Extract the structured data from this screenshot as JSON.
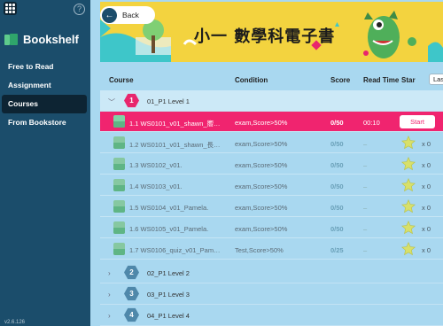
{
  "sidebar": {
    "brand": "Bookshelf",
    "help": "?",
    "items": [
      {
        "label": "Free to Read"
      },
      {
        "label": "Assignment"
      },
      {
        "label": "Courses",
        "active": true
      },
      {
        "label": "From Bookstore"
      }
    ],
    "version": "v2.6.126"
  },
  "header": {
    "back_label": "Back",
    "banner_title": "小一 數學科電子書"
  },
  "table": {
    "columns": {
      "course": "Course",
      "condition": "Condition",
      "score": "Score",
      "read_time": "Read Time",
      "star": "Star",
      "sort": "Last"
    },
    "open_level": {
      "number": "1",
      "name": "01_P1 Level 1"
    },
    "items": [
      {
        "course": "1.1  WS0101_v01_shawn_嚮…",
        "condition": "exam,Score>50%",
        "score": "0/50",
        "time": "00:10",
        "action": "Start"
      },
      {
        "course": "1.2  WS0101_v01_shawn_長…",
        "condition": "exam,Score>50%",
        "score": "0/50",
        "time": "–",
        "stars": "x  0"
      },
      {
        "course": "1.3  WS0102_v01.",
        "condition": "exam,Score>50%",
        "score": "0/50",
        "time": "–",
        "stars": "x  0"
      },
      {
        "course": "1.4  WS0103_v01.",
        "condition": "exam,Score>50%",
        "score": "0/50",
        "time": "–",
        "stars": "x  0"
      },
      {
        "course": "1.5  WS0104_v01_Pamela.",
        "condition": "exam,Score>50%",
        "score": "0/50",
        "time": "–",
        "stars": "x  0"
      },
      {
        "course": "1.6  WS0105_v01_Pamela.",
        "condition": "exam,Score>50%",
        "score": "0/50",
        "time": "–",
        "stars": "x  0"
      },
      {
        "course": "1.7  WS0106_quiz_v01_Pam…",
        "condition": "Test,Score>50%",
        "score": "0/25",
        "time": "–",
        "stars": "x  0"
      }
    ],
    "levels": [
      {
        "number": "2",
        "name": "02_P1 Level 2"
      },
      {
        "number": "3",
        "name": "03_P1 Level 3"
      },
      {
        "number": "4",
        "name": "04_P1 Level 4"
      }
    ]
  }
}
